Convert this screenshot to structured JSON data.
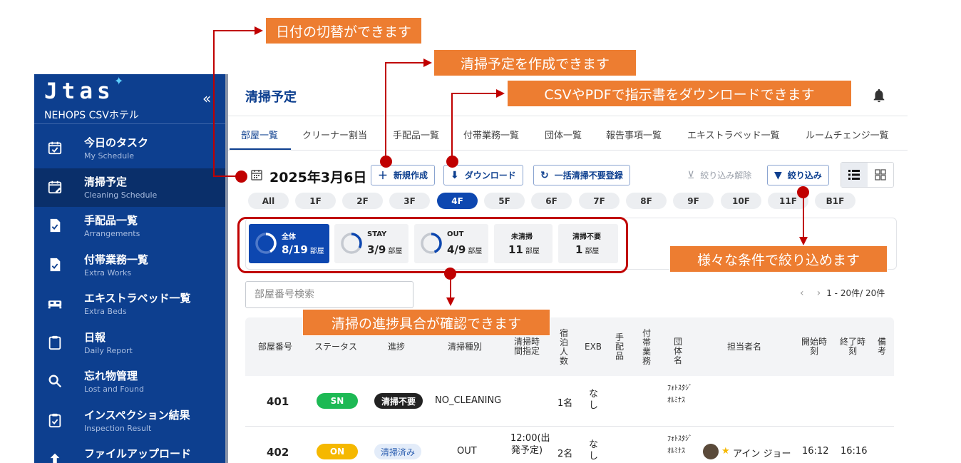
{
  "sidebar": {
    "logo": "Jtas",
    "logo_spark": "✦",
    "collapse_icon": "«",
    "hotel_name": "NEHOPS CSVホテル",
    "items": [
      {
        "label": "今日のタスク",
        "sub": "My Schedule",
        "icon": "calendar-check-icon"
      },
      {
        "label": "清掃予定",
        "sub": "Cleaning Schedule",
        "icon": "calendar-edit-icon"
      },
      {
        "label": "手配品一覧",
        "sub": "Arrangements",
        "icon": "document-check-icon"
      },
      {
        "label": "付帯業務一覧",
        "sub": "Extra Works",
        "icon": "document-check-icon"
      },
      {
        "label": "エキストラベッド一覧",
        "sub": "Extra Beds",
        "icon": "bed-icon"
      },
      {
        "label": "日報",
        "sub": "Daily Report",
        "icon": "clipboard-icon"
      },
      {
        "label": "忘れ物管理",
        "sub": "Lost and Found",
        "icon": "search-icon"
      },
      {
        "label": "インスペクション結果",
        "sub": "Inspection Result",
        "icon": "clipboard-check-icon"
      },
      {
        "label": "ファイルアップロード",
        "sub": "",
        "icon": "upload-icon"
      }
    ]
  },
  "header": {
    "title": "清掃予定"
  },
  "tabs": [
    "部屋一覧",
    "クリーナー割当",
    "手配品一覧",
    "付帯業務一覧",
    "団体一覧",
    "報告事項一覧",
    "エキストラベッド一覧",
    "ルームチェンジ一覧"
  ],
  "toolbar": {
    "date": "2025年3月6日",
    "new_label": "新規作成",
    "download_label": "ダウンロード",
    "bulk_label": "一括清掃不要登録",
    "clear_filter_label": "絞り込み解除",
    "filter_label": "絞り込み"
  },
  "floors": [
    "All",
    "1F",
    "2F",
    "3F",
    "4F",
    "5F",
    "6F",
    "7F",
    "8F",
    "9F",
    "10F",
    "11F",
    "B1F"
  ],
  "active_floor": "4F",
  "stats": [
    {
      "label": "全体",
      "value": "8/19",
      "unit": "部屋",
      "ratio": 0.42
    },
    {
      "label": "STAY",
      "value": "3/9",
      "unit": "部屋",
      "ratio": 0.33
    },
    {
      "label": "OUT",
      "value": "4/9",
      "unit": "部屋",
      "ratio": 0.44
    },
    {
      "label": "未清掃",
      "value": "11",
      "unit": "部屋"
    },
    {
      "label": "清掃不要",
      "value": "1",
      "unit": "部屋"
    }
  ],
  "search": {
    "placeholder": "部屋番号検索"
  },
  "pager": {
    "prev": "‹",
    "next": "›",
    "text": "1 - 20件/ 20件"
  },
  "table": {
    "headers": {
      "room": "部屋番号",
      "status": "ステータス",
      "progress": "進捗",
      "type": "清掃種別",
      "time": "清掃時間指定",
      "guests": "宿泊人数",
      "exb": "EXB",
      "arrangements": "手配品",
      "extra": "付帯業務",
      "group": "団体名",
      "staff": "担当者名",
      "start": "開始時刻",
      "end": "終了時刻",
      "note": "備考"
    },
    "rows": [
      {
        "room": "401",
        "status": "SN",
        "progress": "清掃不要",
        "type": "NO_CLEANING",
        "time": "",
        "guests": "1名",
        "exb": "なし",
        "group": "ﾌｫﾄｽﾀｼﾞｵﾙﾐﾅｽ",
        "staff": "",
        "start": "",
        "end": ""
      },
      {
        "room": "402",
        "status": "ON",
        "progress": "清掃済み",
        "type": "OUT",
        "time": "12:00(出発予定)",
        "guests": "2名",
        "exb": "なし",
        "group": "ﾌｫﾄｽﾀｼﾞｵﾙﾐﾅｽ",
        "staff": "アイン ジョー",
        "start": "16:12",
        "end": "16:16"
      }
    ]
  },
  "annotations": [
    "日付の切替ができます",
    "清掃予定を作成できます",
    "CSVやPDFで指示書をダウンロードできます",
    "様々な条件で絞り込めます",
    "清掃の進捗具合が確認できます"
  ],
  "colors": {
    "sidebar": "#0d3f8f",
    "accent": "#0d47b0",
    "callout": "#ed7d31",
    "annotation_red": "#c00000",
    "sn_green": "#1db954",
    "on_yellow": "#f5b800"
  }
}
